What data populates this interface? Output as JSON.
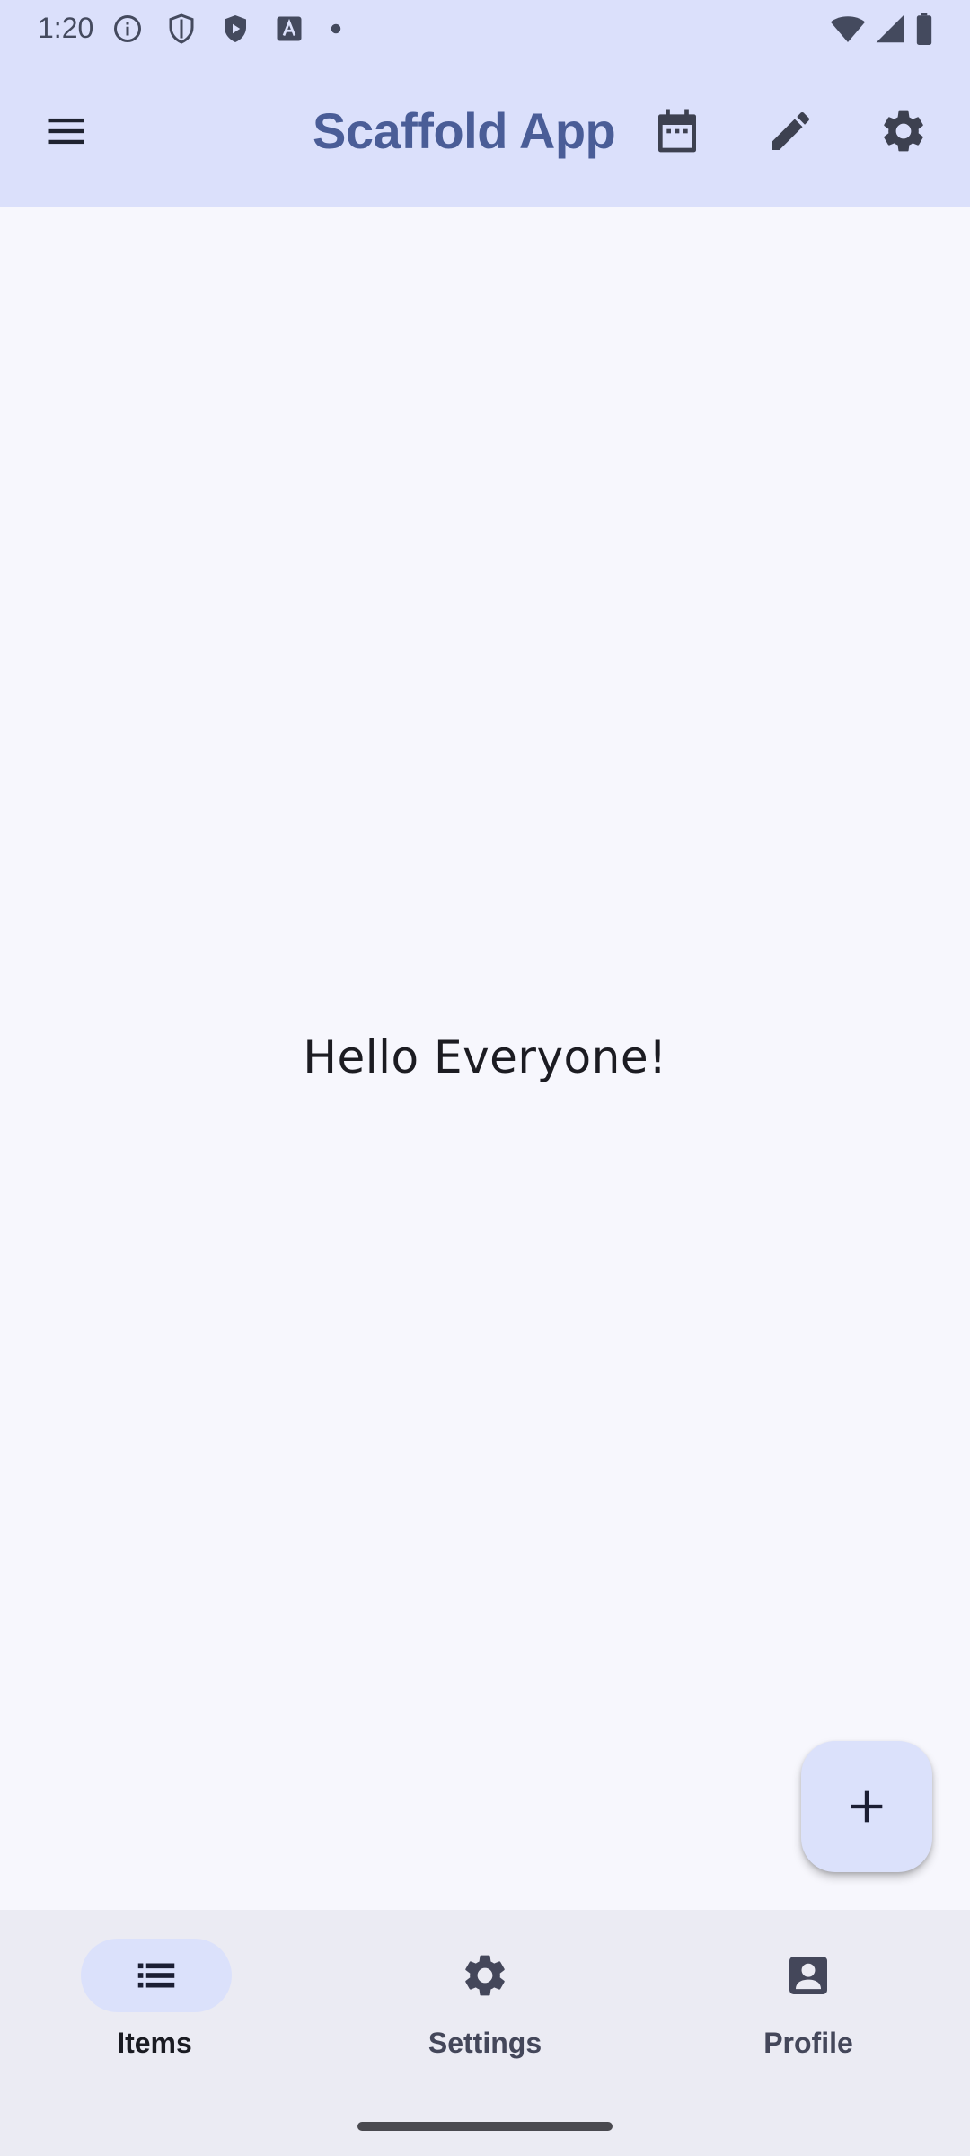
{
  "status_bar": {
    "time": "1:20",
    "icons_left": [
      "info-icon",
      "shield-outline-icon",
      "shield-play-icon",
      "font-a-icon",
      "dot-icon"
    ],
    "icons_right": [
      "wifi-icon",
      "signal-icon",
      "battery-icon"
    ]
  },
  "app_bar": {
    "title": "Scaffold App",
    "title_color": "#4a5d97",
    "background": "#dbe0fb",
    "actions": [
      "menu-icon",
      "calendar-icon",
      "edit-icon",
      "settings-icon"
    ]
  },
  "main": {
    "greeting": "Hello Everyone!"
  },
  "fab": {
    "icon": "plus-icon"
  },
  "bottom_nav": {
    "items": [
      {
        "label": "Items",
        "icon": "list-icon",
        "selected": true
      },
      {
        "label": "Settings",
        "icon": "settings-icon",
        "selected": false
      },
      {
        "label": "Profile",
        "icon": "profile-icon",
        "selected": false
      }
    ]
  }
}
